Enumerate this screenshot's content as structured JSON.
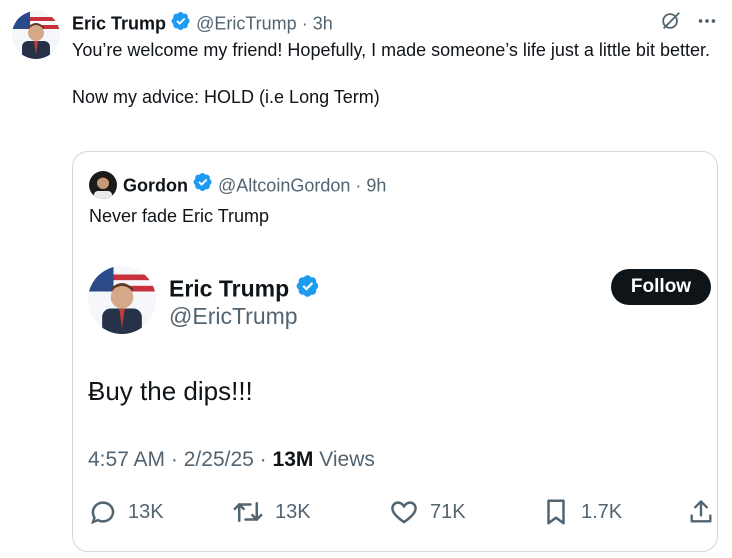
{
  "tweet": {
    "author_name": "Eric Trump",
    "handle": "@EricTrump",
    "separator": "·",
    "time": "3h",
    "text_line1": "You’re welcome my friend! Hopefully, I made someone’s life just a little bit better.",
    "text_line2": "Now my advice: HOLD (i.e Long Term)"
  },
  "top_icons": [
    "grok-icon",
    "more-icon"
  ],
  "quote": {
    "author_name": "Gordon",
    "handle": "@AltcoinGordon",
    "separator": "·",
    "time": "9h",
    "text": "Never fade Eric Trump"
  },
  "embedded": {
    "author_name": "Eric Trump",
    "handle": "@EricTrump",
    "follow_label": "Follow",
    "text": "Ƀuy the dips!!!",
    "time": "4:57 AM",
    "date": "2/25/25",
    "separator": "·",
    "views_count": "13M",
    "views_label": "Views",
    "actions": {
      "replies": "13K",
      "reposts": "13K",
      "likes": "71K",
      "bookmarks": "1.7K"
    }
  },
  "colors": {
    "verified": "#1d9bf0",
    "muted": "#536471",
    "text": "#0f1419",
    "border": "#cfd9de"
  }
}
